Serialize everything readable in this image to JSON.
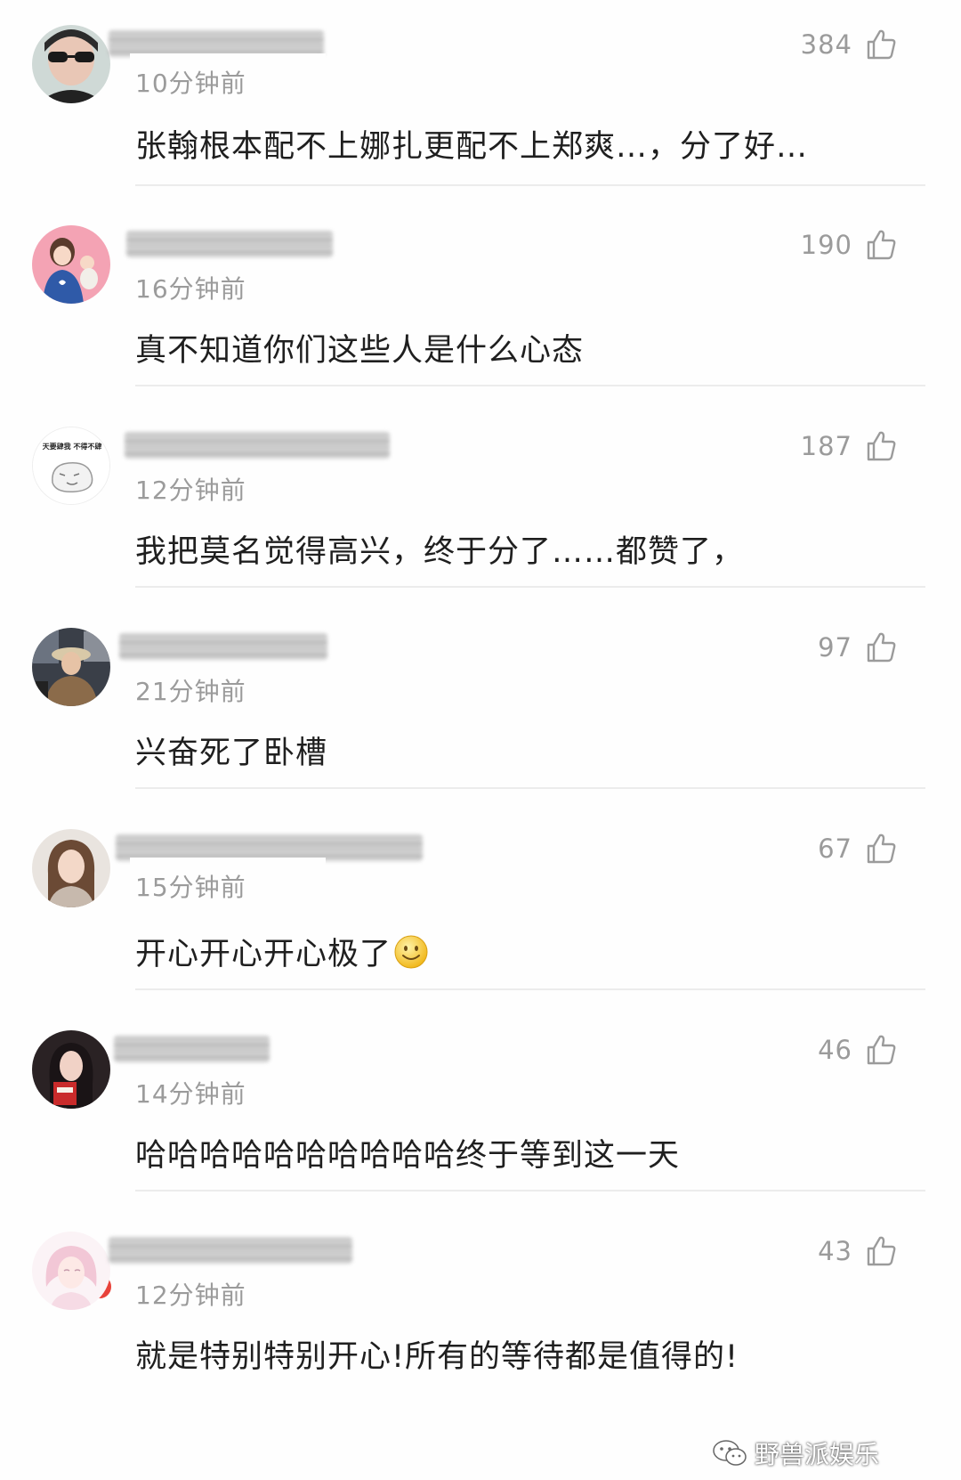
{
  "comments": [
    {
      "time": "10分钟前",
      "text": "张翰根本配不上娜扎更配不上郑爽…，分了好…",
      "likes": "384"
    },
    {
      "time": "16分钟前",
      "text": "真不知道你们这些人是什么心态",
      "likes": "190"
    },
    {
      "time": "12分钟前",
      "text": "我把莫名觉得高兴，终于分了……都赞了，",
      "likes": "187",
      "avatar_text": "天要肆我 不得不肆"
    },
    {
      "time": "21分钟前",
      "text": "兴奋死了卧槽",
      "likes": "97"
    },
    {
      "time": "15分钟前",
      "text": "开心开心开心极了",
      "likes": "67",
      "emoji": "smile"
    },
    {
      "time": "14分钟前",
      "text": "哈哈哈哈哈哈哈哈哈哈终于等到这一天",
      "likes": "46"
    },
    {
      "time": "12分钟前",
      "text": "就是特别特别开心!所有的等待都是值得的!",
      "likes": "43"
    }
  ],
  "watermark": {
    "label": "野兽派娱乐",
    "icon": "wechat-icon"
  },
  "colors": {
    "meta": "#9b9b9b",
    "text": "#1f1f1f",
    "divider": "#ececec",
    "badge": "#e8423a"
  }
}
